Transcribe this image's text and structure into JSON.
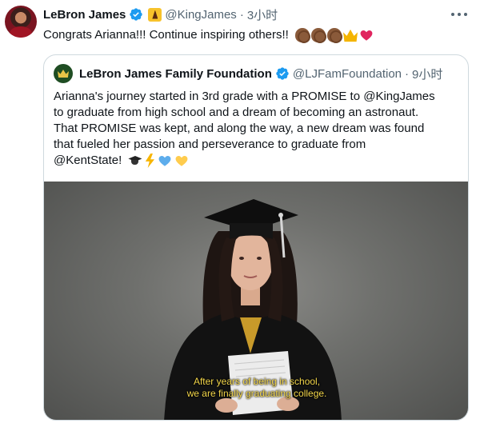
{
  "tweet": {
    "author_name": "LeBron James",
    "handle": "@KingJames",
    "separator": "·",
    "time": "3小时",
    "text": "Congrats Arianna!!! Continue inspiring others!!",
    "emojis": [
      "clapping-hands",
      "clapping-hands",
      "clapping-hands",
      "crown",
      "red-heart"
    ]
  },
  "quote": {
    "author_name": "LeBron James Family Foundation",
    "handle": "@LJFamFoundation",
    "separator": "·",
    "time": "9小时",
    "lines": [
      "Arianna's journey started in 3rd grade with a PROMISE to @KingJames",
      "to graduate from high school and a dream of becoming an astronaut.",
      "That PROMISE was kept, and along the way, a new dream was found",
      "that fueled her passion and perseverance to graduate from",
      "@KentState!"
    ],
    "emojis": [
      "graduation-cap",
      "lightning-bolt",
      "blue-heart",
      "yellow-heart"
    ],
    "video": {
      "caption_line1": "After years of being in school,",
      "caption_line2": "we are finally graduating college."
    }
  },
  "colors": {
    "verified_blue": "#1d9bf0",
    "secondary_text": "#536471",
    "border": "#cfd9de",
    "caption_yellow": "#f3d64a"
  }
}
